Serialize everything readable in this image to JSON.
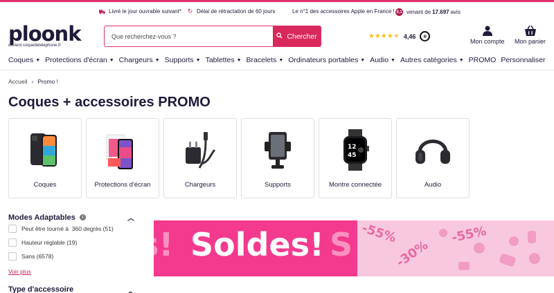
{
  "promo": {
    "delivery": "Livré le jour ouvrable suivant*",
    "returns": "Délai de rétractation de 60 jours",
    "rank": "Le n°1 des accessoires Apple en France !",
    "reviews_badge": "9,1",
    "reviews_text": "venant de",
    "reviews_count": "17.697",
    "reviews_unit": "avis"
  },
  "logo": {
    "name": "ploonk",
    "sub": "devient coquedetelephone.fr"
  },
  "search": {
    "placeholder": "Que recherchez-vous ?",
    "button": "Chercher"
  },
  "rating": {
    "value": "4,46"
  },
  "account": {
    "label": "Mon compte"
  },
  "cart": {
    "label": "Mon panier"
  },
  "nav": {
    "items": [
      "Coques",
      "Protections d'écran",
      "Chargeurs",
      "Supports",
      "Tablettes",
      "Bracelets",
      "Ordinateurs portables",
      "Audio",
      "Autres catégories",
      "PROMO",
      "Personnaliser"
    ]
  },
  "breadcrumb": {
    "home": "Accueil",
    "current": "Promo !"
  },
  "page": {
    "title": "Coques + accessoires PROMO"
  },
  "categories": [
    "Coques",
    "Protections d'écran",
    "Chargeurs",
    "Supports",
    "Montre connectée",
    "Audio"
  ],
  "filters": {
    "modes_title": "Modes Adaptables",
    "options": [
      "Peut être tourné à  360 degrés (51)",
      "Hauteur réglable (19)",
      "Sans (6578)"
    ],
    "more": "Voir plus",
    "type_title": "Type d'accessoire"
  },
  "banner": {
    "title": "Soldes!",
    "pct1": "-55%",
    "pct2": "-30%",
    "pct3": "-55%"
  },
  "colors": {
    "brand": "#1e1b3a",
    "accent": "#d9285c",
    "banner_pink": "#f43a8e"
  }
}
